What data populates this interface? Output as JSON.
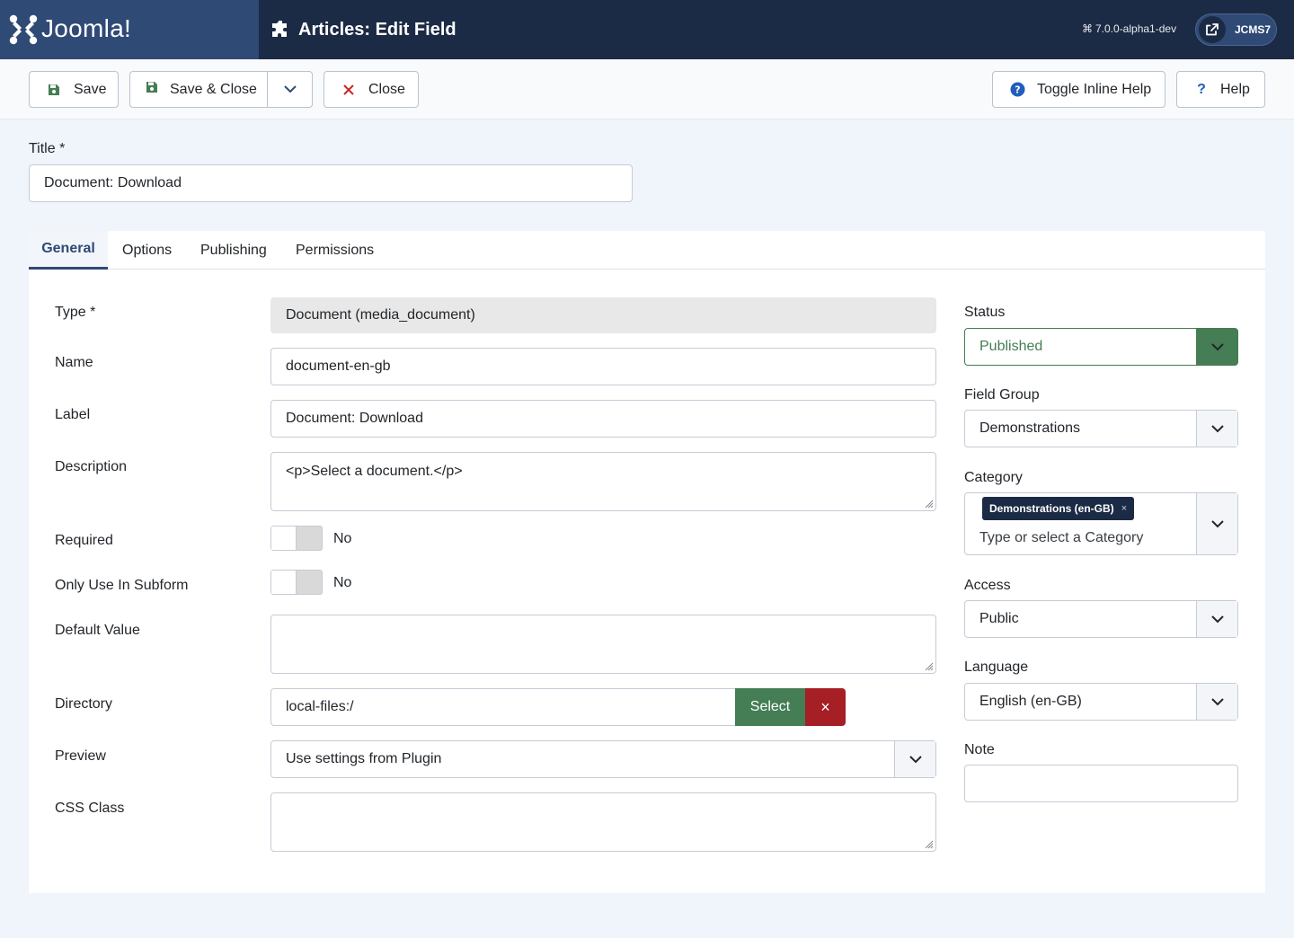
{
  "header": {
    "brand": "Joomla!",
    "page_title": "Articles: Edit Field",
    "version": "7.0.0-alpha1-dev",
    "site_label": "JCMS7"
  },
  "toolbar": {
    "save": "Save",
    "save_close": "Save & Close",
    "close": "Close",
    "toggle_help": "Toggle Inline Help",
    "help": "Help"
  },
  "title_field": {
    "label": "Title *",
    "value": "Document: Download"
  },
  "tabs": [
    {
      "label": "General",
      "active": true
    },
    {
      "label": "Options",
      "active": false
    },
    {
      "label": "Publishing",
      "active": false
    },
    {
      "label": "Permissions",
      "active": false
    }
  ],
  "fields": {
    "type": {
      "label": "Type *",
      "value": "Document (media_document)"
    },
    "name": {
      "label": "Name",
      "value": "document-en-gb"
    },
    "label": {
      "label": "Label",
      "value": "Document: Download"
    },
    "description": {
      "label": "Description",
      "value": "<p>Select a document.</p>"
    },
    "required": {
      "label": "Required",
      "value": "No"
    },
    "subform": {
      "label": "Only Use In Subform",
      "value": "No"
    },
    "default_value": {
      "label": "Default Value",
      "value": ""
    },
    "directory": {
      "label": "Directory",
      "value": "local-files:/",
      "select_label": "Select",
      "clear_label": "×"
    },
    "preview": {
      "label": "Preview",
      "value": "Use settings from Plugin"
    },
    "css_class": {
      "label": "CSS Class",
      "value": ""
    }
  },
  "sidebar": {
    "status": {
      "label": "Status",
      "value": "Published"
    },
    "field_group": {
      "label": "Field Group",
      "value": "Demonstrations"
    },
    "category": {
      "label": "Category",
      "chip": "Demonstrations (en-GB)",
      "chip_remove": "×",
      "placeholder": "Type or select a Category"
    },
    "access": {
      "label": "Access",
      "value": "Public"
    },
    "language": {
      "label": "Language",
      "value": "English (en-GB)"
    },
    "note": {
      "label": "Note",
      "value": ""
    }
  },
  "colors": {
    "header_bg": "#1c2b45",
    "brand_bg": "#2f4a75",
    "success": "#457d54",
    "danger": "#a51f25",
    "page_bg": "#f0f4fb"
  }
}
